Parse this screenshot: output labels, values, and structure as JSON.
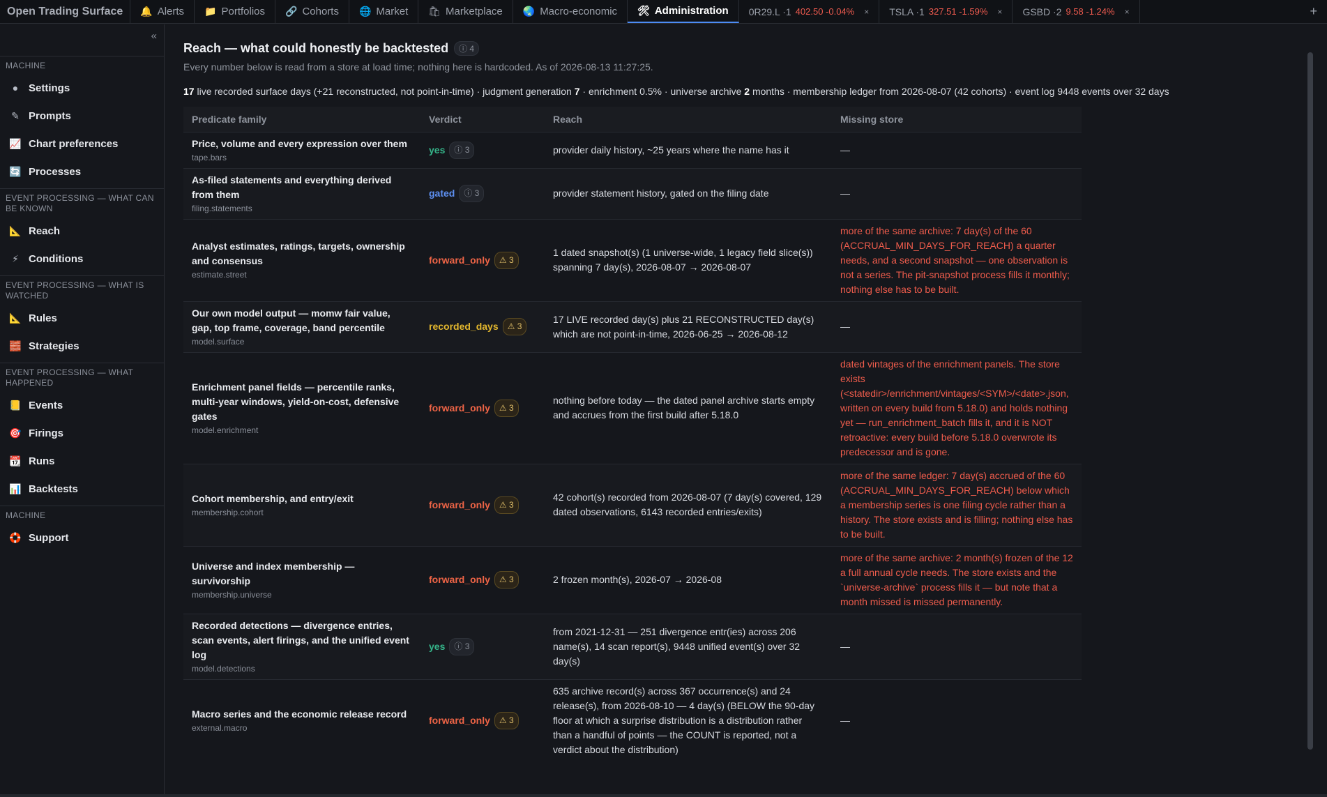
{
  "app": {
    "title": "Open Trading Surface"
  },
  "tabs": [
    {
      "label": "Alerts",
      "icon": "bell-icon",
      "glyph": "🔔"
    },
    {
      "label": "Portfolios",
      "icon": "folder-icon",
      "glyph": "📁"
    },
    {
      "label": "Cohorts",
      "icon": "link-icon",
      "glyph": "🔗"
    },
    {
      "label": "Market",
      "icon": "globe-icon",
      "glyph": "🌐"
    },
    {
      "label": "Marketplace",
      "icon": "shopping-bag-icon",
      "glyph": "🛍"
    },
    {
      "label": "Macro-economic",
      "icon": "earth-icon",
      "glyph": "🌏"
    },
    {
      "label": "Administration",
      "icon": "tools-icon",
      "glyph": "🛠"
    }
  ],
  "tickers": [
    {
      "label": "0R29.L ·1",
      "value": "402.50 -0.04%"
    },
    {
      "label": "TSLA ·1",
      "value": "327.51 -1.59%"
    },
    {
      "label": "GSBD ·2",
      "value": "9.58 -1.24%"
    }
  ],
  "sidebar": {
    "sections": [
      {
        "title": "MACHINE",
        "items": [
          {
            "label": "Settings",
            "icon": "dot-icon",
            "glyph": "●"
          },
          {
            "label": "Prompts",
            "icon": "pen-icon",
            "glyph": "✎"
          },
          {
            "label": "Chart preferences",
            "icon": "chart-icon",
            "glyph": "📈"
          },
          {
            "label": "Processes",
            "icon": "cycle-icon",
            "glyph": "🔄"
          }
        ]
      },
      {
        "title": "EVENT PROCESSING — WHAT CAN BE KNOWN",
        "items": [
          {
            "label": "Reach",
            "icon": "ruler-icon",
            "glyph": "📐"
          },
          {
            "label": "Conditions",
            "icon": "bolt-icon",
            "glyph": "⚡"
          }
        ]
      },
      {
        "title": "EVENT PROCESSING — WHAT IS WATCHED",
        "items": [
          {
            "label": "Rules",
            "icon": "ruler-icon",
            "glyph": "📐"
          },
          {
            "label": "Strategies",
            "icon": "bricks-icon",
            "glyph": "🧱"
          }
        ]
      },
      {
        "title": "EVENT PROCESSING — WHAT HAPPENED",
        "items": [
          {
            "label": "Events",
            "icon": "book-icon",
            "glyph": "📒"
          },
          {
            "label": "Firings",
            "icon": "target-icon",
            "glyph": "🎯"
          },
          {
            "label": "Runs",
            "icon": "calendar-icon",
            "glyph": "📆"
          },
          {
            "label": "Backtests",
            "icon": "bar-chart-icon",
            "glyph": "📊"
          }
        ]
      },
      {
        "title": "MACHINE",
        "items": [
          {
            "label": "Support",
            "icon": "lifebuoy-icon",
            "glyph": "🛟"
          }
        ]
      }
    ]
  },
  "page": {
    "title": "Reach — what could honestly be backtested",
    "title_badge": "ⓘ 4",
    "subtitle": "Every number below is read from a store at load time; nothing here is hardcoded. As of 2026-08-13 11:27:25.",
    "summary": {
      "n1": "17",
      "t1": " live recorded surface days (+21 reconstructed, not point-in-time) · judgment generation ",
      "n2": "7",
      "t2": " · enrichment 0.5% · universe archive ",
      "n3": "2",
      "t3": " months · membership ledger from 2026-08-07 (42 cohorts) · event log 9448 events over 32 days"
    }
  },
  "table": {
    "headers": [
      "Predicate family",
      "Verdict",
      "Reach",
      "Missing store"
    ],
    "rows": [
      {
        "family": "Price, volume and every expression over them",
        "key": "tape.bars",
        "verdict": "yes",
        "vclass": "v-yes",
        "badge": "ⓘ 3",
        "bclass": "",
        "reach": "provider daily history, ~25 years where the name has it",
        "missing": "—",
        "mclass": "dash"
      },
      {
        "family": "As-filed statements and everything derived from them",
        "key": "filing.statements",
        "verdict": "gated",
        "vclass": "v-gated",
        "badge": "ⓘ 3",
        "bclass": "",
        "reach": "provider statement history, gated on the filing date",
        "missing": "—",
        "mclass": "dash"
      },
      {
        "family": "Analyst estimates, ratings, targets, ownership and consensus",
        "key": "estimate.street",
        "verdict": "forward_only",
        "vclass": "v-fwd",
        "badge": "⚠ 3",
        "bclass": "warn",
        "reach": "1 dated snapshot(s) (1 universe-wide, 1 legacy field slice(s)) spanning 7 day(s), 2026-08-07 → 2026-08-07",
        "missing": "more of the same archive: 7 day(s) of the 60 (ACCRUAL_MIN_DAYS_FOR_REACH) a quarter needs, and a second snapshot — one observation is not a series. The pit-snapshot process fills it monthly; nothing else has to be built.",
        "mclass": "missing"
      },
      {
        "family": "Our own model output — momw fair value, gap, top frame, coverage, band percentile",
        "key": "model.surface",
        "verdict": "recorded_days",
        "vclass": "v-rec",
        "badge": "⚠ 3",
        "bclass": "warn",
        "reach": "17 LIVE recorded day(s) plus 21 RECONSTRUCTED day(s) which are not point-in-time, 2026-06-25 → 2026-08-12",
        "missing": "—",
        "mclass": "dash"
      },
      {
        "family": "Enrichment panel fields — percentile ranks, multi-year windows, yield-on-cost, defensive gates",
        "key": "model.enrichment",
        "verdict": "forward_only",
        "vclass": "v-fwd",
        "badge": "⚠ 3",
        "bclass": "warn",
        "reach": "nothing before today — the dated panel archive starts empty and accrues from the first build after 5.18.0",
        "missing": "dated vintages of the enrichment panels. The store exists (<statedir>/enrichment/vintages/<SYM>/<date>.json, written on every build from 5.18.0) and holds nothing yet — run_enrichment_batch fills it, and it is NOT retroactive: every build before 5.18.0 overwrote its predecessor and is gone.",
        "mclass": "missing"
      },
      {
        "family": "Cohort membership, and entry/exit",
        "key": "membership.cohort",
        "verdict": "forward_only",
        "vclass": "v-fwd",
        "badge": "⚠ 3",
        "bclass": "warn",
        "reach": "42 cohort(s) recorded from 2026-08-07 (7 day(s) covered, 129 dated observations, 6143 recorded entries/exits)",
        "missing": "more of the same ledger: 7 day(s) accrued of the 60 (ACCRUAL_MIN_DAYS_FOR_REACH) below which a membership series is one filing cycle rather than a history. The store exists and is filling; nothing else has to be built.",
        "mclass": "missing"
      },
      {
        "family": "Universe and index membership — survivorship",
        "key": "membership.universe",
        "verdict": "forward_only",
        "vclass": "v-fwd",
        "badge": "⚠ 3",
        "bclass": "warn",
        "reach": "2 frozen month(s), 2026-07 → 2026-08",
        "missing": "more of the same archive: 2 month(s) frozen of the 12 a full annual cycle needs. The store exists and the `universe-archive` process fills it — but note that a month missed is missed permanently.",
        "mclass": "missing"
      },
      {
        "family": "Recorded detections — divergence entries, scan events, alert firings, and the unified event log",
        "key": "model.detections",
        "verdict": "yes",
        "vclass": "v-yes",
        "badge": "ⓘ 3",
        "bclass": "",
        "reach": "from 2021-12-31 — 251 divergence entr(ies) across 206 name(s), 14 scan report(s), 9448 unified event(s) over 32 day(s)",
        "missing": "—",
        "mclass": "dash"
      },
      {
        "family": "Macro series and the economic release record",
        "key": "external.macro",
        "verdict": "forward_only",
        "vclass": "v-fwd",
        "badge": "⚠ 3",
        "bclass": "warn",
        "reach": "635 archive record(s) across 367 occurrence(s) and 24 release(s), from 2026-08-10 — 4 day(s) (BELOW the 90-day floor at which a surprise distribution is a distribution rather than a handful of points — the COUNT is reported, not a verdict about the distribution)",
        "missing": "—",
        "mclass": "dash"
      }
    ]
  }
}
